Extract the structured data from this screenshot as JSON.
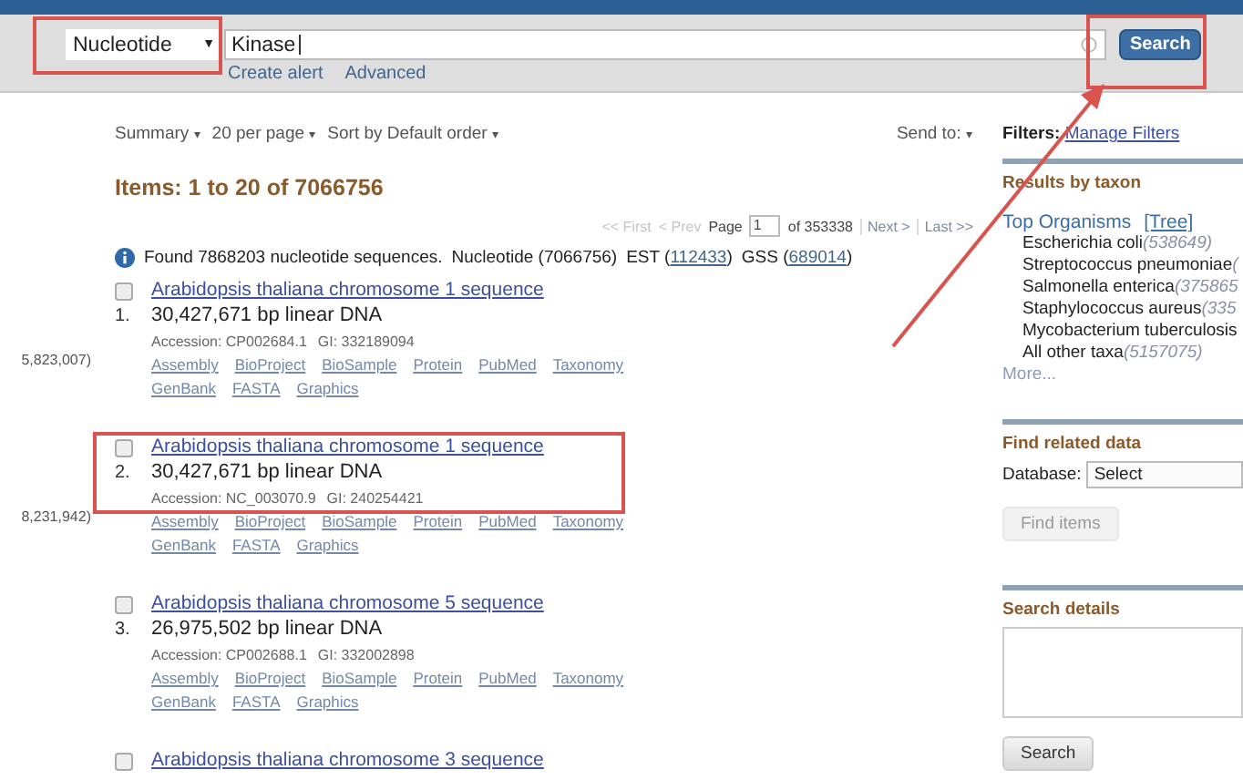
{
  "search_bar": {
    "database": "Nucleotide",
    "database_caret": "▼",
    "query": "Kinase",
    "button": "Search",
    "links": [
      "Create alert",
      "Advanced"
    ]
  },
  "toolbar": {
    "menus": [
      "Summary",
      "20 per page",
      "Sort by Default order"
    ],
    "send_to": "Send to:",
    "caret": "▾"
  },
  "results_heading": "Items: 1 to 20 of 7066756",
  "pager": {
    "first": "<< First",
    "prev": "< Prev",
    "page_label": "Page",
    "page": "1",
    "of": "of 353338",
    "next": "Next >",
    "last": "Last >>"
  },
  "found": {
    "text": "Found 7868203 nucleotide sequences.",
    "nucleotide": "Nucleotide (7066756)",
    "est_label": "EST (",
    "est": "112433",
    "est_end": ")",
    "gss_label": "GSS (",
    "gss": "689014",
    "gss_end": ")"
  },
  "results": [
    {
      "number": "1.",
      "title": "Arabidopsis thaliana chromosome 1 sequence",
      "size": "30,427,671 bp linear DNA",
      "accession": "Accession: CP002684.1",
      "gi": "GI: 332189094",
      "links": [
        "Assembly",
        "BioProject",
        "BioSample",
        "Protein",
        "PubMed",
        "Taxonomy"
      ],
      "links2": [
        "GenBank",
        "FASTA",
        "Graphics"
      ],
      "left_note": "5,823,007)",
      "checked": false
    },
    {
      "number": "2.",
      "title": "Arabidopsis thaliana chromosome 1 sequence",
      "size": "30,427,671 bp linear DNA",
      "accession": "Accession: NC_003070.9",
      "gi": "GI: 240254421",
      "links": [
        "Assembly",
        "BioProject",
        "BioSample",
        "Protein",
        "PubMed",
        "Taxonomy"
      ],
      "links2": [
        "GenBank",
        "FASTA",
        "Graphics"
      ],
      "left_note": "8,231,942)",
      "checked": false
    },
    {
      "number": "3.",
      "title": "Arabidopsis thaliana chromosome 5 sequence",
      "size": "26,975,502 bp linear DNA",
      "accession": "Accession: CP002688.1",
      "gi": "GI: 332002898",
      "links": [
        "Assembly",
        "BioProject",
        "BioSample",
        "Protein",
        "PubMed",
        "Taxonomy"
      ],
      "links2": [
        "GenBank",
        "FASTA",
        "Graphics"
      ],
      "checked": false
    },
    {
      "title": "Arabidopsis thaliana chromosome 3 sequence",
      "checked": false
    }
  ],
  "sidebar": {
    "filters_label": "Filters:",
    "manage_filters": "Manage Filters",
    "taxon_heading": "Results by taxon",
    "top_organisms": "Top Organisms",
    "tree": "[Tree]",
    "organisms": [
      {
        "name": "Escherichia coli",
        "count": "(538649)"
      },
      {
        "name": "Streptococcus pneumoniae",
        "count": "("
      },
      {
        "name": "Salmonella enterica",
        "count": "(375865"
      },
      {
        "name": "Staphylococcus aureus",
        "count": "(335"
      },
      {
        "name": "Mycobacterium tuberculosis"
      },
      {
        "name": "All other taxa",
        "count": "(5157075)"
      }
    ],
    "more": "More...",
    "related_heading": "Find related data",
    "database_label": "Database:",
    "database_select": "Select",
    "find_items": "Find items",
    "find_items_disabled": true,
    "details_heading": "Search details",
    "details_search": "Search"
  }
}
